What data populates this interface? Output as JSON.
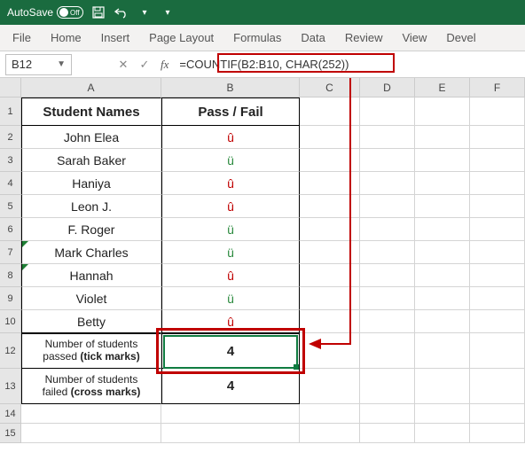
{
  "titlebar": {
    "autosave_label": "AutoSave",
    "autosave_state": "Off"
  },
  "ribbon": {
    "file": "File",
    "home": "Home",
    "insert": "Insert",
    "page_layout": "Page Layout",
    "formulas": "Formulas",
    "data": "Data",
    "review": "Review",
    "view": "View",
    "developer": "Devel"
  },
  "fxbar": {
    "namebox": "B12",
    "fx_label": "fx",
    "formula": "=COUNTIF(B2:B10, CHAR(252))"
  },
  "columns": {
    "A": "A",
    "B": "B",
    "C": "C",
    "D": "D",
    "E": "E",
    "F": "F"
  },
  "headers": {
    "A": "Student Names",
    "B": "Pass / Fail"
  },
  "students": [
    {
      "name": "John Elea",
      "status": "fail"
    },
    {
      "name": "Sarah Baker",
      "status": "pass"
    },
    {
      "name": "Haniya",
      "status": "fail"
    },
    {
      "name": "Leon J.",
      "status": "fail"
    },
    {
      "name": "F. Roger",
      "status": "pass"
    },
    {
      "name": "Mark Charles",
      "status": "pass"
    },
    {
      "name": "Hannah",
      "status": "fail"
    },
    {
      "name": "Violet",
      "status": "pass"
    },
    {
      "name": "Betty",
      "status": "fail"
    }
  ],
  "summary": {
    "passed_label_1": "Number of students",
    "passed_label_2": "passed (tick marks)",
    "passed_value": "4",
    "failed_label_1": "Number of students",
    "failed_label_2": "failed (cross marks)",
    "failed_value": "4"
  },
  "rownums": [
    "1",
    "2",
    "3",
    "4",
    "5",
    "6",
    "7",
    "8",
    "9",
    "10",
    "12",
    "13",
    "14",
    "15"
  ],
  "glyphs": {
    "pass": "ü",
    "fail": "û"
  }
}
